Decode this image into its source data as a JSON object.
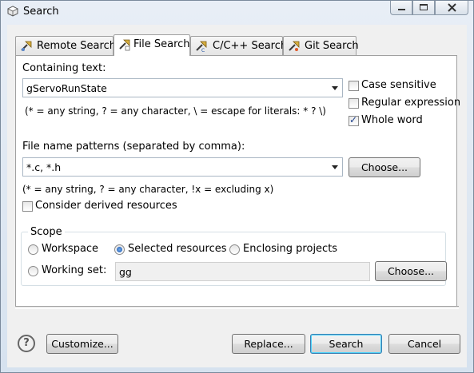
{
  "window": {
    "title": "Search"
  },
  "tabs": [
    {
      "label": "Remote Search",
      "icon": "remote-search-icon",
      "active": false
    },
    {
      "label": "File Search",
      "icon": "file-search-icon",
      "active": true
    },
    {
      "label": "C/C++ Search",
      "icon": "cpp-search-icon",
      "active": false
    },
    {
      "label": "Git Search",
      "icon": "git-search-icon",
      "active": false
    }
  ],
  "containing": {
    "label": "Containing text:",
    "value": "gServoRunState",
    "hint": "(* = any string, ? = any character, \\ = escape for literals: * ? \\)"
  },
  "options": {
    "case_sensitive": {
      "label": "Case sensitive",
      "checked": false
    },
    "regular_expression": {
      "label": "Regular expression",
      "checked": false
    },
    "whole_word": {
      "label": "Whole word",
      "checked": true
    }
  },
  "patterns": {
    "label": "File name patterns (separated by comma):",
    "value": "*.c, *.h",
    "choose_label": "Choose...",
    "hint": "(* = any string, ? = any character, !x = excluding x)"
  },
  "derived": {
    "label": "Consider derived resources",
    "checked": false
  },
  "scope": {
    "title": "Scope",
    "workspace": {
      "label": "Workspace",
      "selected": false
    },
    "selected_resources": {
      "label": "Selected resources",
      "selected": true
    },
    "enclosing_projects": {
      "label": "Enclosing projects",
      "selected": false
    },
    "working_set": {
      "label": "Working set:",
      "selected": false,
      "value": "gg"
    },
    "choose_label": "Choose..."
  },
  "footer": {
    "help": "?",
    "customize": "Customize...",
    "replace": "Replace...",
    "search": "Search",
    "cancel": "Cancel"
  },
  "colors": {
    "window_frame": "#d6e2ef",
    "default_button_border": "#3c7fb1",
    "checkmark": "#1c3f8a"
  }
}
